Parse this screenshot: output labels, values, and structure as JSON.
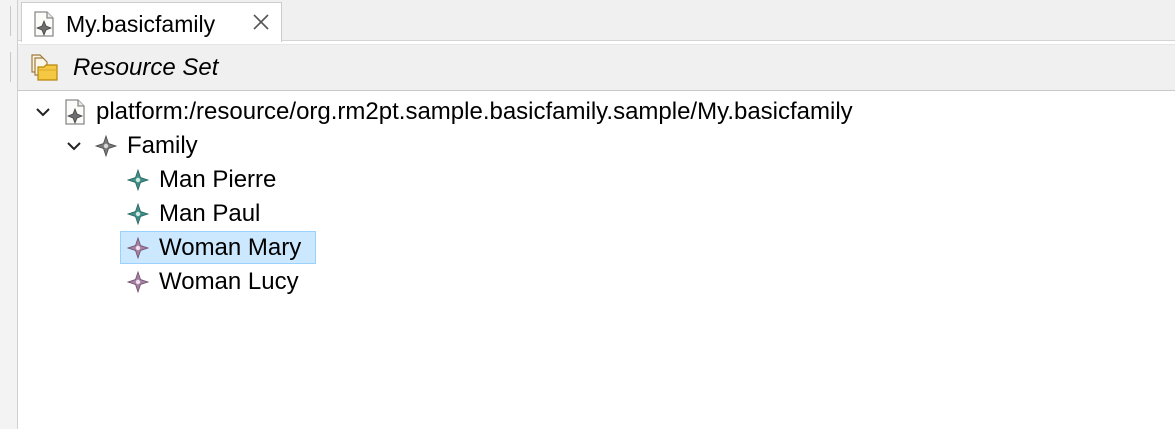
{
  "editor_tab": {
    "title": "My.basicfamily",
    "icon": "model-file-icon",
    "close_icon": "close-icon"
  },
  "header": {
    "title": "Resource Set",
    "icon": "resource-set-folder-icon"
  },
  "tree": {
    "root": {
      "label": "platform:/resource/org.rm2pt.sample.basicfamily.sample/My.basicfamily",
      "expanded": true,
      "icon": "model-file-icon"
    },
    "family": {
      "label": "Family",
      "expanded": true,
      "icon": "family-node-icon"
    },
    "members": [
      {
        "label": "Man Pierre",
        "icon": "man-node-icon",
        "selected": false
      },
      {
        "label": "Man Paul",
        "icon": "man-node-icon",
        "selected": false
      },
      {
        "label": "Woman Mary",
        "icon": "woman-node-icon",
        "selected": true
      },
      {
        "label": "Woman Lucy",
        "icon": "woman-node-icon",
        "selected": false
      }
    ]
  },
  "colors": {
    "selection_fill": "#cce8ff",
    "selection_border": "#99d1ff",
    "man_icon": "#3f8f86",
    "woman_icon": "#a880a4",
    "family_icon": "#6f6f6f"
  }
}
